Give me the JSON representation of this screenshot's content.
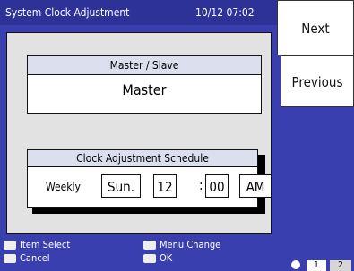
{
  "header": {
    "title": "System Clock Adjustment",
    "datetime": "10/12 07:02"
  },
  "master_slave": {
    "heading": "Master / Slave",
    "value": "Master"
  },
  "schedule": {
    "heading": "Clock Adjustment Schedule",
    "frequency": "Weekly",
    "day": "Sun.",
    "hour": "12",
    "minute": "00",
    "ampm": "AM"
  },
  "side_buttons": {
    "next": "Next",
    "previous": "Previous"
  },
  "footer": {
    "item_select": "Item Select",
    "cancel": "Cancel",
    "menu_change": "Menu Change",
    "ok": "OK",
    "page_current": "1",
    "page_total": "2"
  }
}
